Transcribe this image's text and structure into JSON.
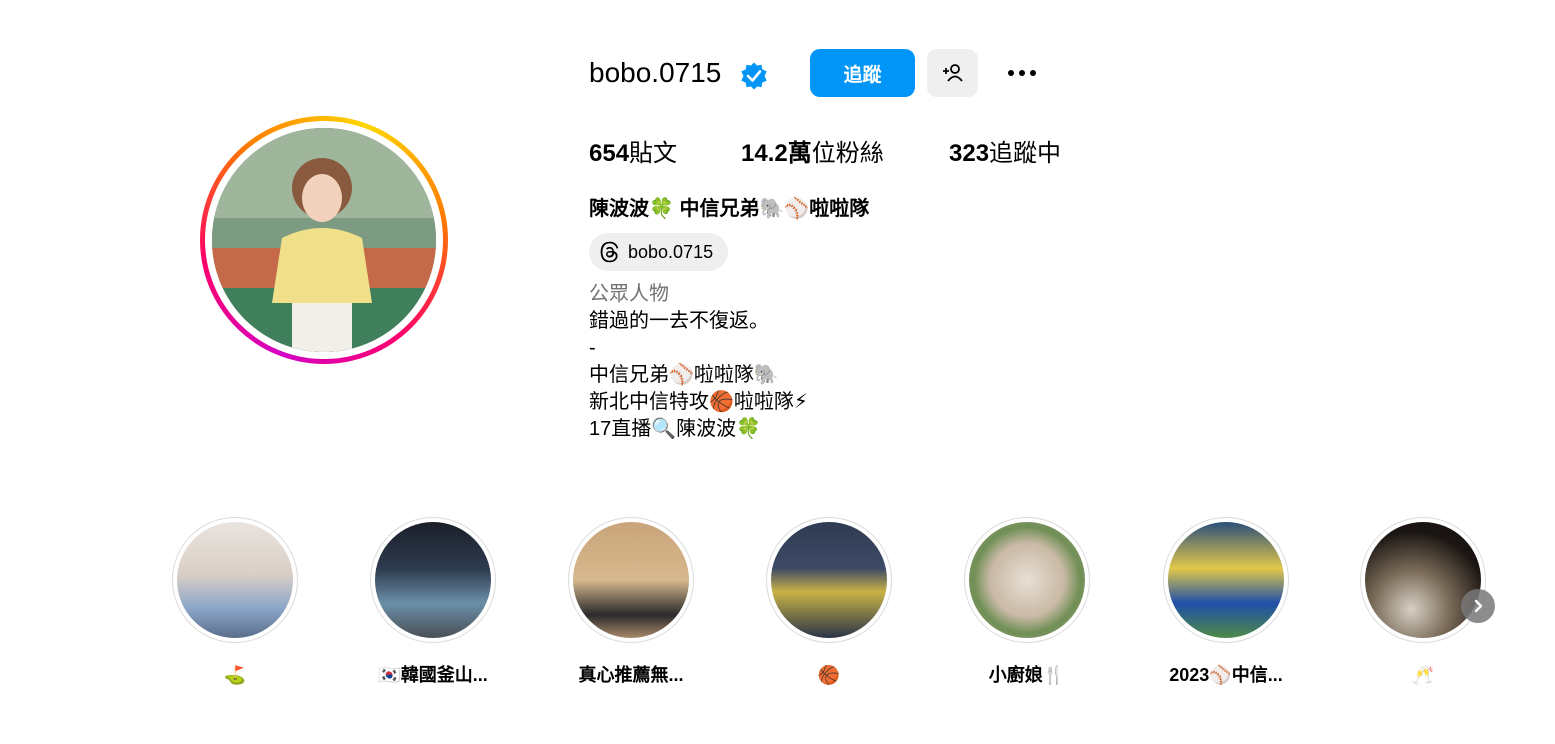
{
  "profile": {
    "username": "bobo.0715",
    "follow_label": "追蹤",
    "posts_count": "654",
    "posts_label": "貼文",
    "followers_count": "14.2萬",
    "followers_label": "位粉絲",
    "following_count": "323",
    "following_label": "追蹤中",
    "full_name": "陳波波🍀 中信兄弟🐘⚾啦啦隊",
    "threads_handle": "bobo.0715",
    "category": "公眾人物",
    "bio_lines": [
      "錯過的一去不復返。",
      "-",
      "中信兄弟⚾啦啦隊🐘",
      "新北中信特攻🏀啦啦隊⚡",
      "17直播🔍陳波波🍀"
    ]
  },
  "highlights": [
    {
      "label": "⛳"
    },
    {
      "label": "🇰🇷韓國釜山..."
    },
    {
      "label": "真心推薦無..."
    },
    {
      "label": "🏀"
    },
    {
      "label": "小廚娘🍴"
    },
    {
      "label": "2023⚾中信..."
    },
    {
      "label": "🥂"
    }
  ],
  "icons": {
    "verified": "verified-badge-icon",
    "add_user": "add-user-icon",
    "more": "more-options-icon",
    "threads": "threads-icon",
    "next": "chevron-right-icon"
  },
  "colors": {
    "accent": "#0095f6",
    "secondary_text": "#737373",
    "button_gray": "#efefef"
  }
}
